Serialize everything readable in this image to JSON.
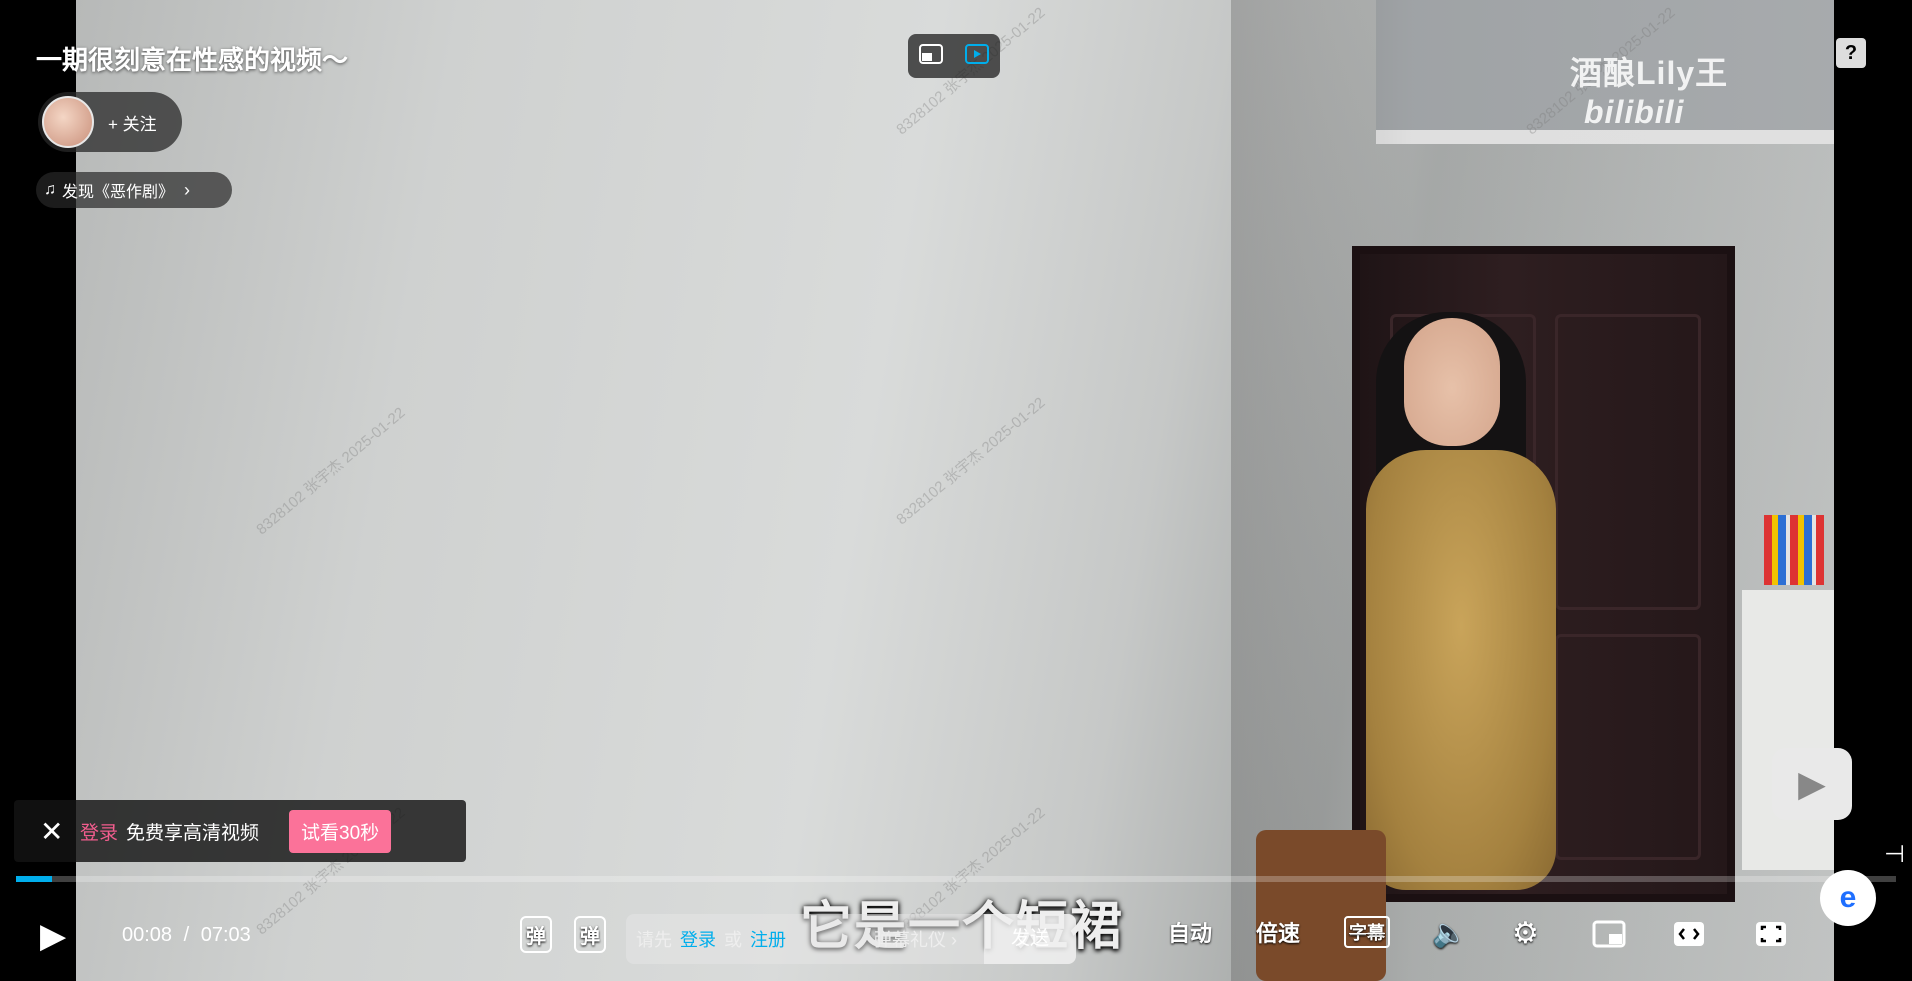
{
  "video": {
    "title": "一期很刻意在性感的视频～",
    "channel_watermark": "酒酿Lily王",
    "bilibili_mark": "bilibili",
    "user_watermark": "8328102 张宇杰 2025-01-22",
    "subtitle": "它是一个短裙"
  },
  "author": {
    "follow_label": "+ 关注"
  },
  "music": {
    "icon": "music-note-icon",
    "label": "发现《恶作剧》",
    "arrow": "›"
  },
  "top_buttons": {
    "icons": [
      "exit-pip-icon",
      "mini-player-icon"
    ],
    "help": "?"
  },
  "login_banner": {
    "close": "✕",
    "login_link": "登录",
    "text": "免费享高清视频",
    "trial_button": "试看30秒"
  },
  "progress": {
    "fraction": 0.019,
    "accent": "#00aeec"
  },
  "controls": {
    "current_time": "00:08",
    "separator": "/",
    "duration": "07:03",
    "danmaku_toggle_icon": "弹",
    "danmaku_settings_icon": "弹",
    "input_prefix": "请先",
    "input_login": "登录",
    "input_or": "或",
    "input_register": "注册",
    "etiquette": "弹幕礼仪 ›",
    "send": "发送",
    "auto": "自动",
    "speed": "倍速",
    "subtitle_toggle": "字幕",
    "volume_icon": "volume-icon",
    "settings_icon": "gear-icon",
    "pip_icon": "picture-in-picture-icon",
    "widescreen_icon": "widescreen-icon",
    "fullscreen_icon": "fullscreen-icon"
  },
  "colors": {
    "brand_pink": "#fb7299",
    "link_blue": "#00aeec"
  }
}
